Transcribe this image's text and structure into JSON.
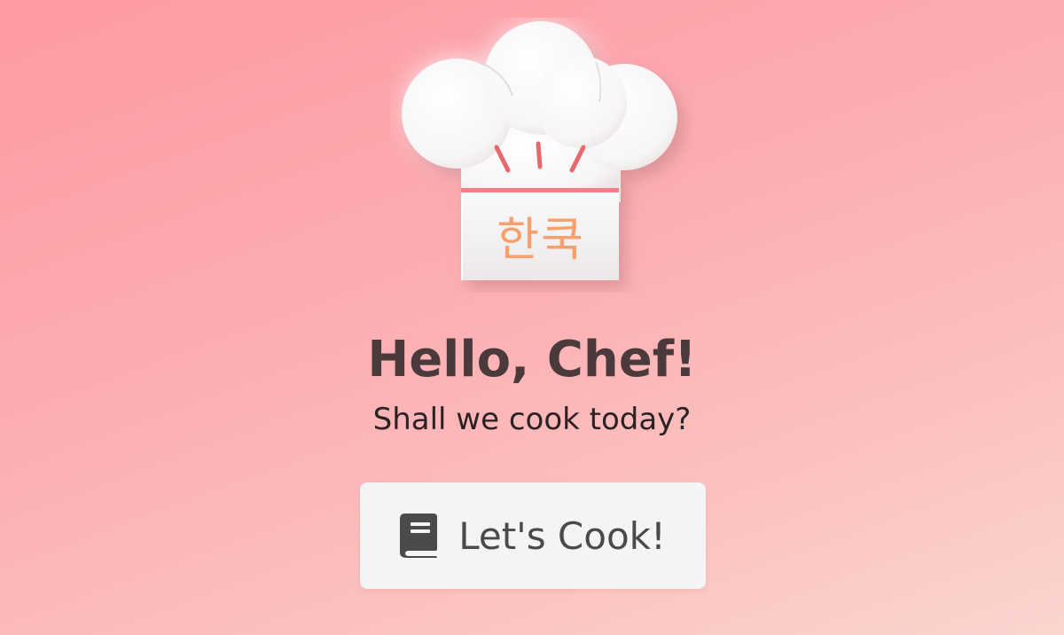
{
  "hat": {
    "label": "한쿡",
    "icon": "chef-hat-icon"
  },
  "greeting": {
    "title": "Hello, Chef!",
    "subtitle": "Shall we cook today?"
  },
  "cta": {
    "label": "Let's Cook!",
    "icon": "book-icon"
  },
  "colors": {
    "background_start": "#fd9aa3",
    "background_end": "#fbd5cf",
    "hat_label": "#f7a06e",
    "hat_stripe": "#f27f82",
    "title": "#4b3a3c",
    "button_bg": "#f4f4f4",
    "button_text": "#4a4a4a"
  }
}
